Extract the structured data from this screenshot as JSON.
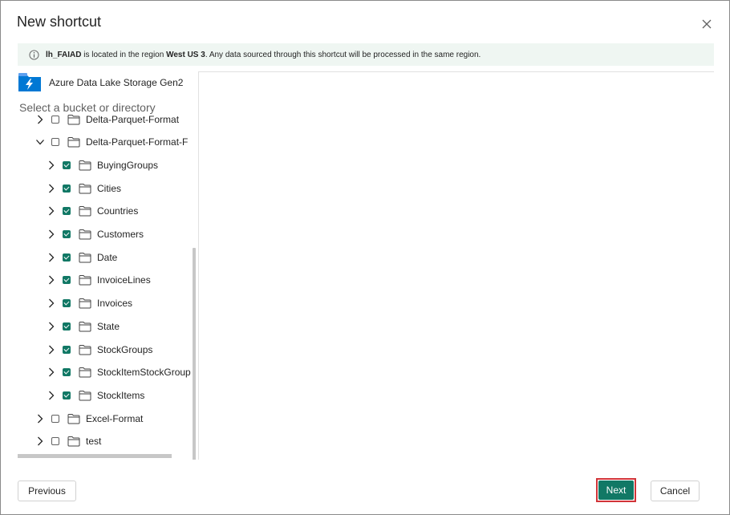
{
  "dialog": {
    "title": "New shortcut"
  },
  "info": {
    "lakehouse": "lh_FAIAD",
    "text1": " is located in the region ",
    "region": "West US 3",
    "text2": ". Any data sourced through this shortcut will be processed in the same region."
  },
  "source": {
    "icon": "azure-data-lake-icon",
    "label": "Azure Data Lake Storage Gen2"
  },
  "tree": {
    "hint": "Select a bucket or directory",
    "items": [
      {
        "label": "Delta-Parquet-Format",
        "checked": false,
        "expanded": false,
        "level": 0
      },
      {
        "label": "Delta-Parquet-Format-F",
        "checked": false,
        "expanded": true,
        "level": 0
      },
      {
        "label": "BuyingGroups",
        "checked": true,
        "expanded": false,
        "level": 1
      },
      {
        "label": "Cities",
        "checked": true,
        "expanded": false,
        "level": 1
      },
      {
        "label": "Countries",
        "checked": true,
        "expanded": false,
        "level": 1
      },
      {
        "label": "Customers",
        "checked": true,
        "expanded": false,
        "level": 1
      },
      {
        "label": "Date",
        "checked": true,
        "expanded": false,
        "level": 1
      },
      {
        "label": "InvoiceLines",
        "checked": true,
        "expanded": false,
        "level": 1
      },
      {
        "label": "Invoices",
        "checked": true,
        "expanded": false,
        "level": 1
      },
      {
        "label": "State",
        "checked": true,
        "expanded": false,
        "level": 1
      },
      {
        "label": "StockGroups",
        "checked": true,
        "expanded": false,
        "level": 1
      },
      {
        "label": "StockItemStockGroup",
        "checked": true,
        "expanded": false,
        "level": 1
      },
      {
        "label": "StockItems",
        "checked": true,
        "expanded": false,
        "level": 1
      },
      {
        "label": "Excel-Format",
        "checked": false,
        "expanded": false,
        "level": 0
      },
      {
        "label": "test",
        "checked": false,
        "expanded": false,
        "level": 0
      }
    ]
  },
  "footer": {
    "previous_label": "Previous",
    "next_label": "Next",
    "cancel_label": "Cancel"
  },
  "colors": {
    "accent": "#117865",
    "info_bg": "#eff6f2",
    "highlight": "#d13438"
  }
}
